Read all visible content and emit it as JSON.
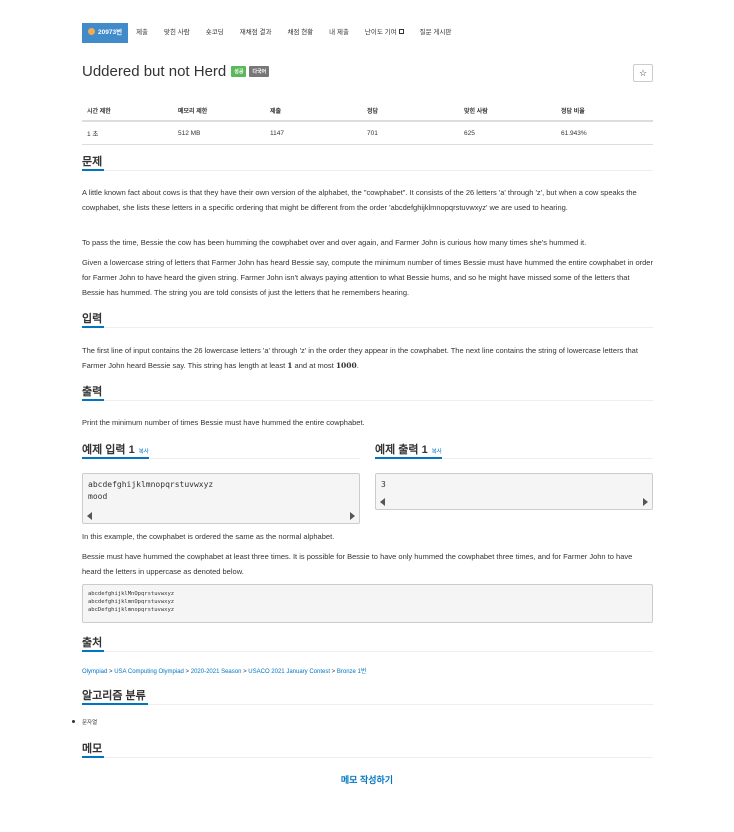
{
  "nav": {
    "items": [
      {
        "label": "20973번",
        "active": true
      },
      {
        "label": "제출"
      },
      {
        "label": "맞힌 사람"
      },
      {
        "label": "숏코딩"
      },
      {
        "label": "재채점 결과"
      },
      {
        "label": "채점 현황"
      },
      {
        "label": "내 제출"
      },
      {
        "label": "난이도 기여"
      },
      {
        "label": "질문 게시판"
      }
    ]
  },
  "problem": {
    "title": "Uddered but not Herd",
    "badges": [
      "성공",
      "다국어"
    ],
    "star": "☆"
  },
  "info_table": {
    "headers": [
      "시간 제한",
      "메모리 제한",
      "제출",
      "정답",
      "맞힌 사람",
      "정답 비율"
    ],
    "values": [
      "1 초",
      "512 MB",
      "1147",
      "701",
      "625",
      "61.943%"
    ]
  },
  "sections": {
    "description": "문제",
    "input": "입력",
    "output": "출력",
    "sample_input": "예제 입력 1",
    "sample_output": "예제 출력 1",
    "copy": "복사",
    "source": "출처",
    "algorithm": "알고리즘 분류",
    "memo": "메모"
  },
  "description": {
    "p1": "A little known fact about cows is that they have their own version of the alphabet, the \"cowphabet\". It consists of the 26 letters 'a' through 'z', but when a cow speaks the cowphabet, she lists these letters in a specific ordering that might be different from the order 'abcdefghijklmnopqrstuvwxyz' we are used to hearing.",
    "p2": "To pass the time, Bessie the cow has been humming the cowphabet over and over again, and Farmer John is curious how many times she's hummed it.",
    "p3": "Given a lowercase string of letters that Farmer John has heard Bessie say, compute the minimum number of times Bessie must have hummed the entire cowphabet in order for Farmer John to have heard the given string. Farmer John isn't always paying attention to what Bessie hums, and so he might have missed some of the letters that Bessie has hummed. The string you are told consists of just the letters that he remembers hearing."
  },
  "input_text": {
    "before": "The first line of input contains the 26 lowercase letters 'a' through 'z' in the order they appear in the cowphabet. The next line contains the string of lowercase letters that Farmer John heard Bessie say. This string has length at least ",
    "min": "1",
    "middle": " and at most ",
    "max": "1000",
    "after": "."
  },
  "output_text": "Print the minimum number of times Bessie must have hummed the entire cowphabet.",
  "sample_input": "abcdefghijklmnopqrstuvwxyz\nmood",
  "sample_output": "3",
  "explanation": {
    "p1": "In this example, the cowphabet is ordered the same as the normal alphabet.",
    "p2": "Bessie must have hummed the cowphabet at least three times. It is possible for Bessie to have only hummed the cowphabet three times, and for Farmer John to have heard the letters in uppercase as denoted below.",
    "code": "abcdefghijklMnOpqrstuvwxyz\nabcdefghijklmnOpqrstuvwxyz\nabcDefghijklmnopqrstuvwxyz"
  },
  "source": {
    "crumbs": [
      "Olympiad",
      "USA Computing Olympiad",
      "2020-2021 Season",
      "USACO 2021 January Contest",
      "Bronze 1번"
    ],
    "sep": " > "
  },
  "algorithm_items": [
    "문자열"
  ],
  "memo_button": "메모 작성하기"
}
